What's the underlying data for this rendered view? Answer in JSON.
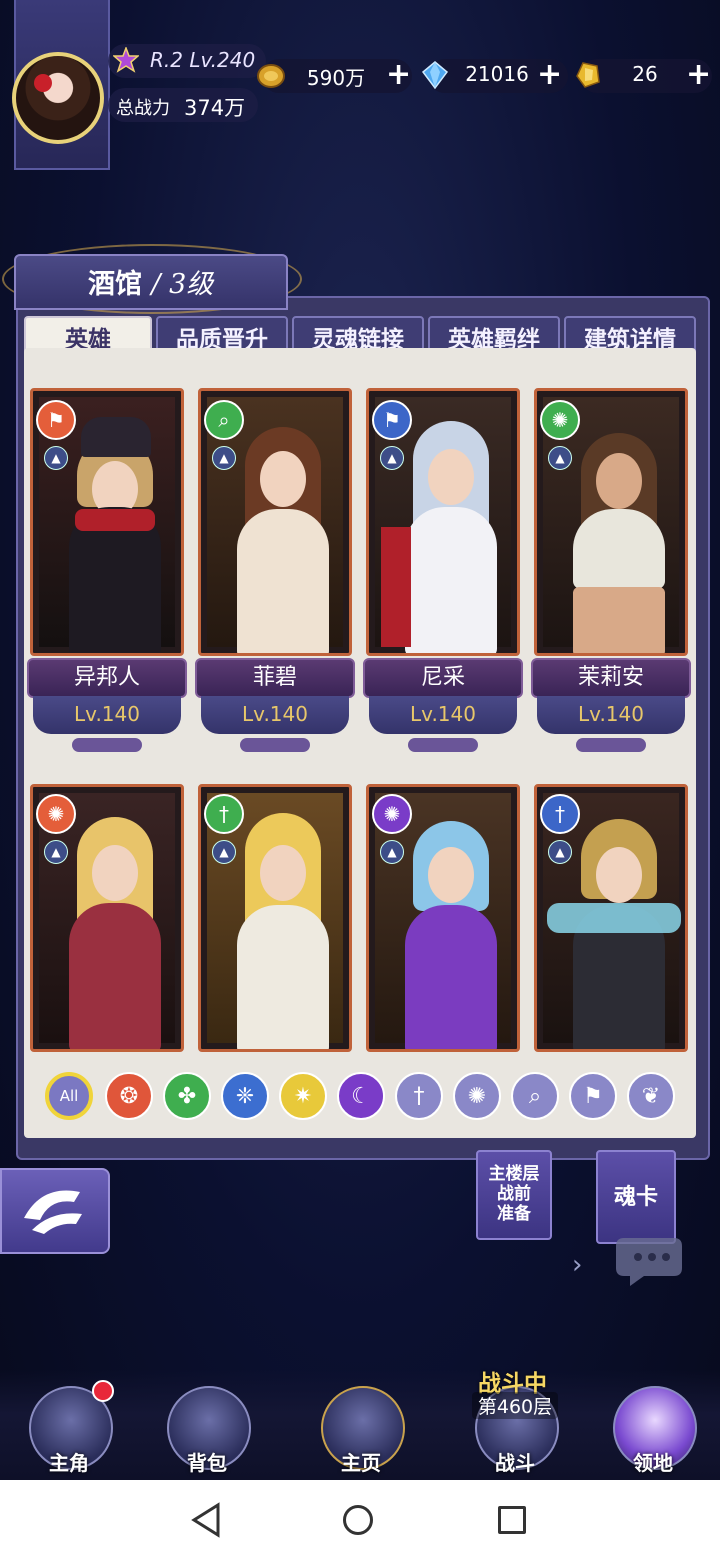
{
  "player": {
    "rank_level": "R.2 Lv.240",
    "power_label": "总战力",
    "power_value": "374万",
    "avatar_icon": "player-avatar"
  },
  "resources": [
    {
      "icon": "gold-coin-icon",
      "value": "590万",
      "color": "#d8a12a"
    },
    {
      "icon": "diamond-icon",
      "value": "21016",
      "color": "#4fa8f0"
    },
    {
      "icon": "gold-gem-icon",
      "value": "26",
      "color": "#e8b92e"
    }
  ],
  "panel": {
    "title": "酒馆",
    "level": "/ 3级"
  },
  "tabs": [
    {
      "label": "英雄",
      "active": true
    },
    {
      "label": "品质晋升",
      "active": false
    },
    {
      "label": "灵魂链接",
      "active": false
    },
    {
      "label": "英雄羁绊",
      "active": false
    },
    {
      "label": "建筑详情",
      "active": false
    }
  ],
  "heroes": [
    {
      "name": "异邦人",
      "level": "Lv.140",
      "element": "banner-icon",
      "element_color": "#e45e3a",
      "class_icon": "hat-icon"
    },
    {
      "name": "菲碧",
      "level": "Lv.140",
      "element": "magnifier-icon",
      "element_color": "#3fae4f",
      "class_icon": "hat-icon"
    },
    {
      "name": "尼采",
      "level": "Lv.140",
      "element": "banner-icon",
      "element_color": "#3c66c8",
      "class_icon": "hat-icon"
    },
    {
      "name": "茉莉安",
      "level": "Lv.140",
      "element": "swirl-icon",
      "element_color": "#3fae4f",
      "class_icon": "hat-icon"
    },
    {
      "name": "",
      "level": "",
      "element": "swirl-icon",
      "element_color": "#e45e3a",
      "class_icon": "hat-icon"
    },
    {
      "name": "",
      "level": "",
      "element": "sword-icon",
      "element_color": "#3fae4f",
      "class_icon": "hat-icon"
    },
    {
      "name": "",
      "level": "",
      "element": "swirl-icon",
      "element_color": "#7a3cc8",
      "class_icon": "hat-icon"
    },
    {
      "name": "",
      "level": "",
      "element": "sword-icon",
      "element_color": "#3c66c8",
      "class_icon": "hat-icon"
    }
  ],
  "filters": [
    {
      "label": "All",
      "icon": "all-filter",
      "color": "#7b78c2"
    },
    {
      "label": "",
      "icon": "fire-element-icon",
      "color": "#e0563a"
    },
    {
      "label": "",
      "icon": "wind-element-icon",
      "color": "#3fae4f"
    },
    {
      "label": "",
      "icon": "water-element-icon",
      "color": "#3c6ed0"
    },
    {
      "label": "",
      "icon": "light-element-icon",
      "color": "#e8c93a"
    },
    {
      "label": "",
      "icon": "dark-element-icon",
      "color": "#7a3cc8"
    },
    {
      "label": "",
      "icon": "sword-class-icon",
      "color": "#8a88c8"
    },
    {
      "label": "",
      "icon": "swirl-class-icon",
      "color": "#8a88c8"
    },
    {
      "label": "",
      "icon": "magnifier-class-icon",
      "color": "#8a88c8"
    },
    {
      "label": "",
      "icon": "banner-class-icon",
      "color": "#8a88c8"
    },
    {
      "label": "",
      "icon": "wing-class-icon",
      "color": "#8a88c8"
    }
  ],
  "side_buttons": {
    "prep": "主楼层\n战前\n准备",
    "soul_card": "魂卡"
  },
  "bottom_nav": [
    {
      "label": "主角",
      "icon": "hero-nav-icon"
    },
    {
      "label": "背包",
      "icon": "bag-nav-icon"
    },
    {
      "label": "主页",
      "icon": "home-book-nav-icon"
    },
    {
      "label": "战斗",
      "icon": "battle-nav-icon"
    },
    {
      "label": "领地",
      "icon": "territory-nav-icon"
    }
  ],
  "battle": {
    "status": "战斗中",
    "floor": "第460层"
  }
}
